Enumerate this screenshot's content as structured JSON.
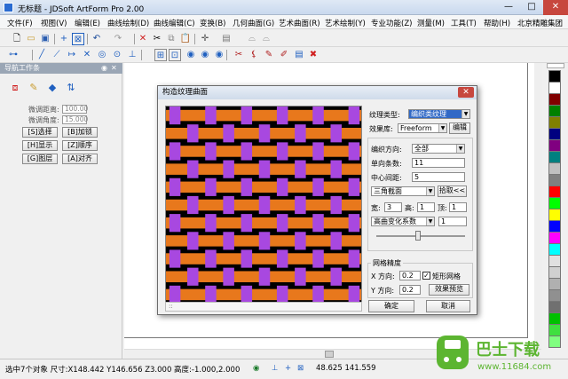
{
  "window": {
    "title": "无标题 - JDSoft ArtForm Pro 2.00",
    "min": "—",
    "max": "□",
    "close": "✕"
  },
  "menu": [
    "文件(F)",
    "视图(V)",
    "编辑(E)",
    "曲线绘制(D)",
    "曲线编辑(C)",
    "变换(B)",
    "几何曲面(G)",
    "艺术曲面(R)",
    "艺术绘制(Y)",
    "专业功能(Z)",
    "测量(M)",
    "工具(T)",
    "帮助(H)",
    "北京精雕集团"
  ],
  "panel": {
    "title": "导航工作条",
    "pin": "◉",
    "close": "✕",
    "offset_label": "微调距离:",
    "offset_value": "100.00",
    "angle_label": "微调角度:",
    "angle_value": "15.000",
    "buttons": [
      "[S]选择",
      "[B]加锁",
      "[H]显示",
      "[Z]顺序",
      "[G]图层",
      "[A]对齐"
    ]
  },
  "status": {
    "selection": "选中7个对象 尺寸:X148.442 Y146.656 Z3.000 高度:-1.000,2.000",
    "coords": "48.625 141.559"
  },
  "dialog": {
    "title": "构造纹理曲面",
    "close": "✕",
    "texture_type_label": "纹理类型:",
    "texture_type_value": "编织类纹理",
    "effect_lib_label": "效果库:",
    "effect_lib_value": "Freeform",
    "edit_button": "编辑",
    "direction_label": "编织方向:",
    "direction_value": "全部",
    "unit_count_label": "单向条数:",
    "unit_count_value": "11",
    "center_gap_label": "中心间距:",
    "center_gap_value": "5",
    "section_value": "三角截面",
    "pick_button": "拾取<<",
    "width_label": "宽:",
    "width_value": "3",
    "height_label": "高:",
    "height_value": "1",
    "top_label": "顶:",
    "top_value": "1",
    "variation_value": "高曲变化系数",
    "variation_num": "1",
    "grid_group_label": "网格精度",
    "x_dir_label": "X 方向:",
    "x_dir_value": "0.2",
    "rect_grid_label": "矩形网格",
    "rect_grid_checked": "✓",
    "y_dir_label": "Y 方向:",
    "y_dir_value": "0.2",
    "preview_button": "效果预览",
    "ok_button": "确定",
    "cancel_button": "取消",
    "strip_text": "::"
  },
  "chart_colors": {
    "orange": "#e8781c",
    "violet": "#a848e0"
  },
  "watermark": {
    "brand": "巴士下载",
    "url": "www.11684.com"
  }
}
